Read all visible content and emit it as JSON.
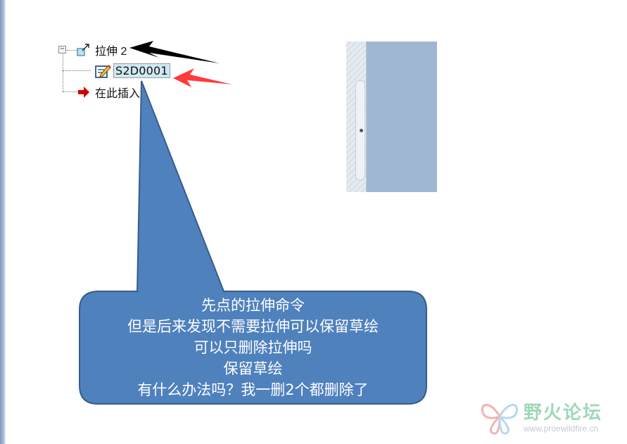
{
  "model_tree": {
    "items": [
      {
        "label": "拉伸 2",
        "icon": "extrude-icon"
      },
      {
        "label": "S2D0001",
        "icon": "sketch-icon",
        "selected": true
      },
      {
        "label": "在此插入",
        "icon": "insert-here-arrow-icon"
      }
    ]
  },
  "callout": {
    "lines": [
      "先点的拉伸命令",
      "但是后来发现不需要拉伸可以保留草绘",
      "可以只删除拉伸吗",
      "保留草绘",
      "有什么办法吗？我一删2个都删除了"
    ],
    "fill": "#4f81bd",
    "stroke": "#385d8a"
  },
  "annotation_arrows": [
    {
      "name": "black-arrow",
      "color": "#000000"
    },
    {
      "name": "red-arrow",
      "color": "#ff3b3b"
    }
  ],
  "watermark": {
    "title": "野火论坛",
    "url": "www.proewildfire.cn"
  }
}
